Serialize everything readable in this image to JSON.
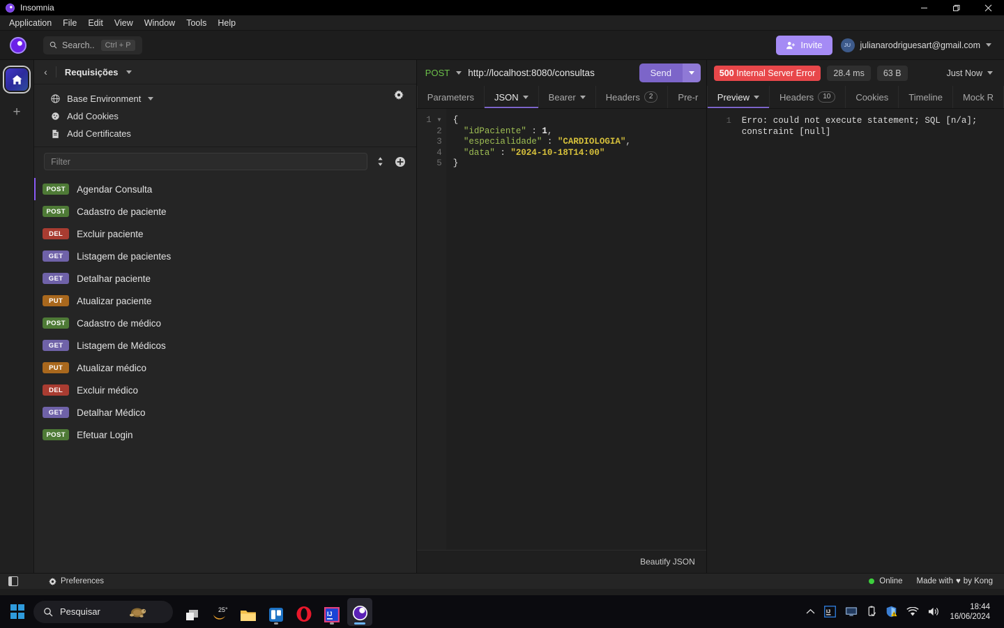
{
  "window": {
    "app_title": "Insomnia",
    "minimize": "—",
    "maximize": "❐",
    "close": "✕"
  },
  "menubar": [
    "Application",
    "File",
    "Edit",
    "View",
    "Window",
    "Tools",
    "Help"
  ],
  "toolbar": {
    "search_label": "Search..",
    "search_shortcut": "Ctrl + P",
    "invite_label": "Invite",
    "account_initials": "JU",
    "account_email": "julianarodriguesart@gmail.com"
  },
  "sidebar": {
    "title": "Requisições",
    "environment": "Base Environment",
    "add_cookies": "Add Cookies",
    "add_certificates": "Add Certificates",
    "filter_placeholder": "Filter",
    "requests": [
      {
        "method": "POST",
        "name": "Agendar Consulta",
        "active": true
      },
      {
        "method": "POST",
        "name": "Cadastro de paciente",
        "active": false
      },
      {
        "method": "DEL",
        "name": "Excluir paciente",
        "active": false
      },
      {
        "method": "GET",
        "name": "Listagem de pacientes",
        "active": false
      },
      {
        "method": "GET",
        "name": "Detalhar paciente",
        "active": false
      },
      {
        "method": "PUT",
        "name": "Atualizar paciente",
        "active": false
      },
      {
        "method": "POST",
        "name": "Cadastro de médico",
        "active": false
      },
      {
        "method": "GET",
        "name": "Listagem de Médicos",
        "active": false
      },
      {
        "method": "PUT",
        "name": "Atualizar médico",
        "active": false
      },
      {
        "method": "DEL",
        "name": "Excluir médico",
        "active": false
      },
      {
        "method": "GET",
        "name": "Detalhar Médico",
        "active": false
      },
      {
        "method": "POST",
        "name": "Efetuar Login",
        "active": false
      }
    ]
  },
  "request": {
    "method": "POST",
    "url": "http://localhost:8080/consultas",
    "send_label": "Send",
    "tabs": [
      {
        "label": "Parameters",
        "active": false,
        "caret": false,
        "count": null
      },
      {
        "label": "JSON",
        "active": true,
        "caret": true,
        "count": null
      },
      {
        "label": "Bearer",
        "active": false,
        "caret": true,
        "count": null
      },
      {
        "label": "Headers",
        "active": false,
        "caret": false,
        "count": "2"
      },
      {
        "label": "Pre-r",
        "active": false,
        "caret": false,
        "count": null
      }
    ],
    "body_lines": [
      {
        "num": "1",
        "fold": true,
        "tokens": [
          {
            "t": "b",
            "v": "{"
          }
        ]
      },
      {
        "num": "2",
        "fold": false,
        "tokens": [
          {
            "t": "p",
            "v": "  "
          },
          {
            "t": "k",
            "v": "\"idPaciente\""
          },
          {
            "t": "p",
            "v": " : "
          },
          {
            "t": "n",
            "v": "1"
          },
          {
            "t": "p",
            "v": ","
          }
        ]
      },
      {
        "num": "3",
        "fold": false,
        "tokens": [
          {
            "t": "p",
            "v": "  "
          },
          {
            "t": "k",
            "v": "\"especialidade\""
          },
          {
            "t": "p",
            "v": " : "
          },
          {
            "t": "s",
            "v": "\"CARDIOLOGIA\""
          },
          {
            "t": "p",
            "v": ","
          }
        ]
      },
      {
        "num": "4",
        "fold": false,
        "tokens": [
          {
            "t": "p",
            "v": "  "
          },
          {
            "t": "k",
            "v": "\"data\""
          },
          {
            "t": "p",
            "v": " : "
          },
          {
            "t": "s",
            "v": "\"2024-10-18T14:00\""
          }
        ]
      },
      {
        "num": "5",
        "fold": false,
        "tokens": [
          {
            "t": "b",
            "v": "}"
          }
        ]
      }
    ],
    "beautify_label": "Beautify JSON"
  },
  "response": {
    "status_code": "500",
    "status_text": "Internal Server Error",
    "time": "28.4 ms",
    "size": "63 B",
    "when": "Just Now",
    "tabs": [
      {
        "label": "Preview",
        "active": true,
        "caret": true,
        "count": null
      },
      {
        "label": "Headers",
        "active": false,
        "caret": false,
        "count": "10"
      },
      {
        "label": "Cookies",
        "active": false,
        "caret": false,
        "count": null
      },
      {
        "label": "Timeline",
        "active": false,
        "caret": false,
        "count": null
      },
      {
        "label": "Mock R",
        "active": false,
        "caret": false,
        "count": null
      }
    ],
    "line_number": "1",
    "body": "Erro: could not execute statement; SQL [n/a];\nconstraint [null]"
  },
  "statusbar": {
    "preferences": "Preferences",
    "online": "Online",
    "made_with_prefix": "Made with",
    "made_with_suffix": "by Kong",
    "heart": "♥"
  },
  "taskbar": {
    "search_placeholder": "Pesquisar",
    "weather_temp": "25°",
    "time": "18:44",
    "date": "16/06/2024"
  },
  "colors": {
    "accent_purple": "#7c65c9",
    "status_error": "#e8474a",
    "method_post": "#4e7a36",
    "method_get": "#6f62a8",
    "method_del": "#a93c31",
    "method_put": "#a9681d",
    "online_green": "#3dcf3d"
  }
}
